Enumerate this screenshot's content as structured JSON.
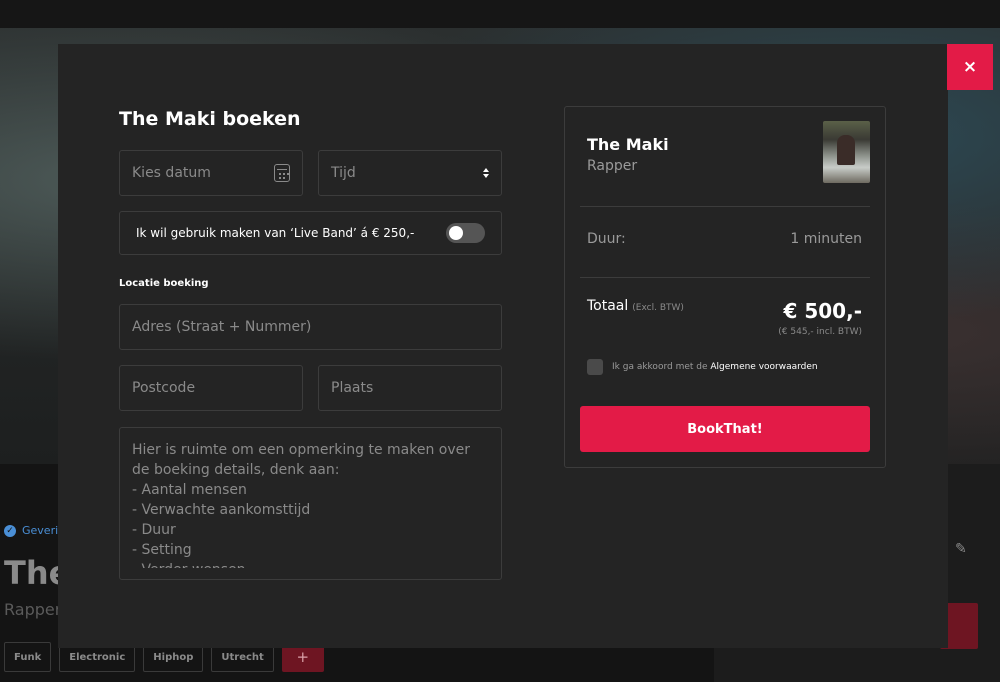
{
  "background": {
    "verified_label": "Geverif",
    "artist_name": "The",
    "artist_role": "Rapper",
    "tags": [
      "Funk",
      "Electronic",
      "Hiphop",
      "Utrecht"
    ],
    "add_tag_label": "+"
  },
  "modal": {
    "close_label": "×",
    "title": "The Maki boeken",
    "date_placeholder": "Kies datum",
    "time_placeholder": "Tijd",
    "live_band_label": "Ik wil gebruik maken van ‘Live Band’ á € 250,-",
    "live_band_enabled": false,
    "location_label": "Locatie boeking",
    "address_placeholder": "Adres (Straat + Nummer)",
    "postcode_placeholder": "Postcode",
    "city_placeholder": "Plaats",
    "notes_placeholder": "Hier is ruimte om een opmerking te maken over de boeking details, denk aan:\n- Aantal mensen\n- Verwachte aankomsttijd\n- Duur\n- Setting\n- Verder wensen"
  },
  "summary": {
    "artist_name": "The Maki",
    "artist_role": "Rapper",
    "duration_label": "Duur:",
    "duration_value": "1 minuten",
    "total_label": "Totaal",
    "total_excl": "(Excl. BTW)",
    "total_value": "€ 500,-",
    "total_incl": "(€ 545,- incl. BTW)",
    "terms_prefix": "Ik ga akkoord met de",
    "terms_link": "Algemene voorwaarden",
    "book_button": "BookThat!"
  },
  "colors": {
    "accent": "#e31b47",
    "modal_bg": "#242424",
    "border": "#3c3c3c"
  },
  "icons": {
    "close": "close-icon",
    "calendar": "calendar-icon",
    "select": "select-arrows-icon",
    "verified": "verified-check-icon",
    "edit": "pencil-icon"
  }
}
